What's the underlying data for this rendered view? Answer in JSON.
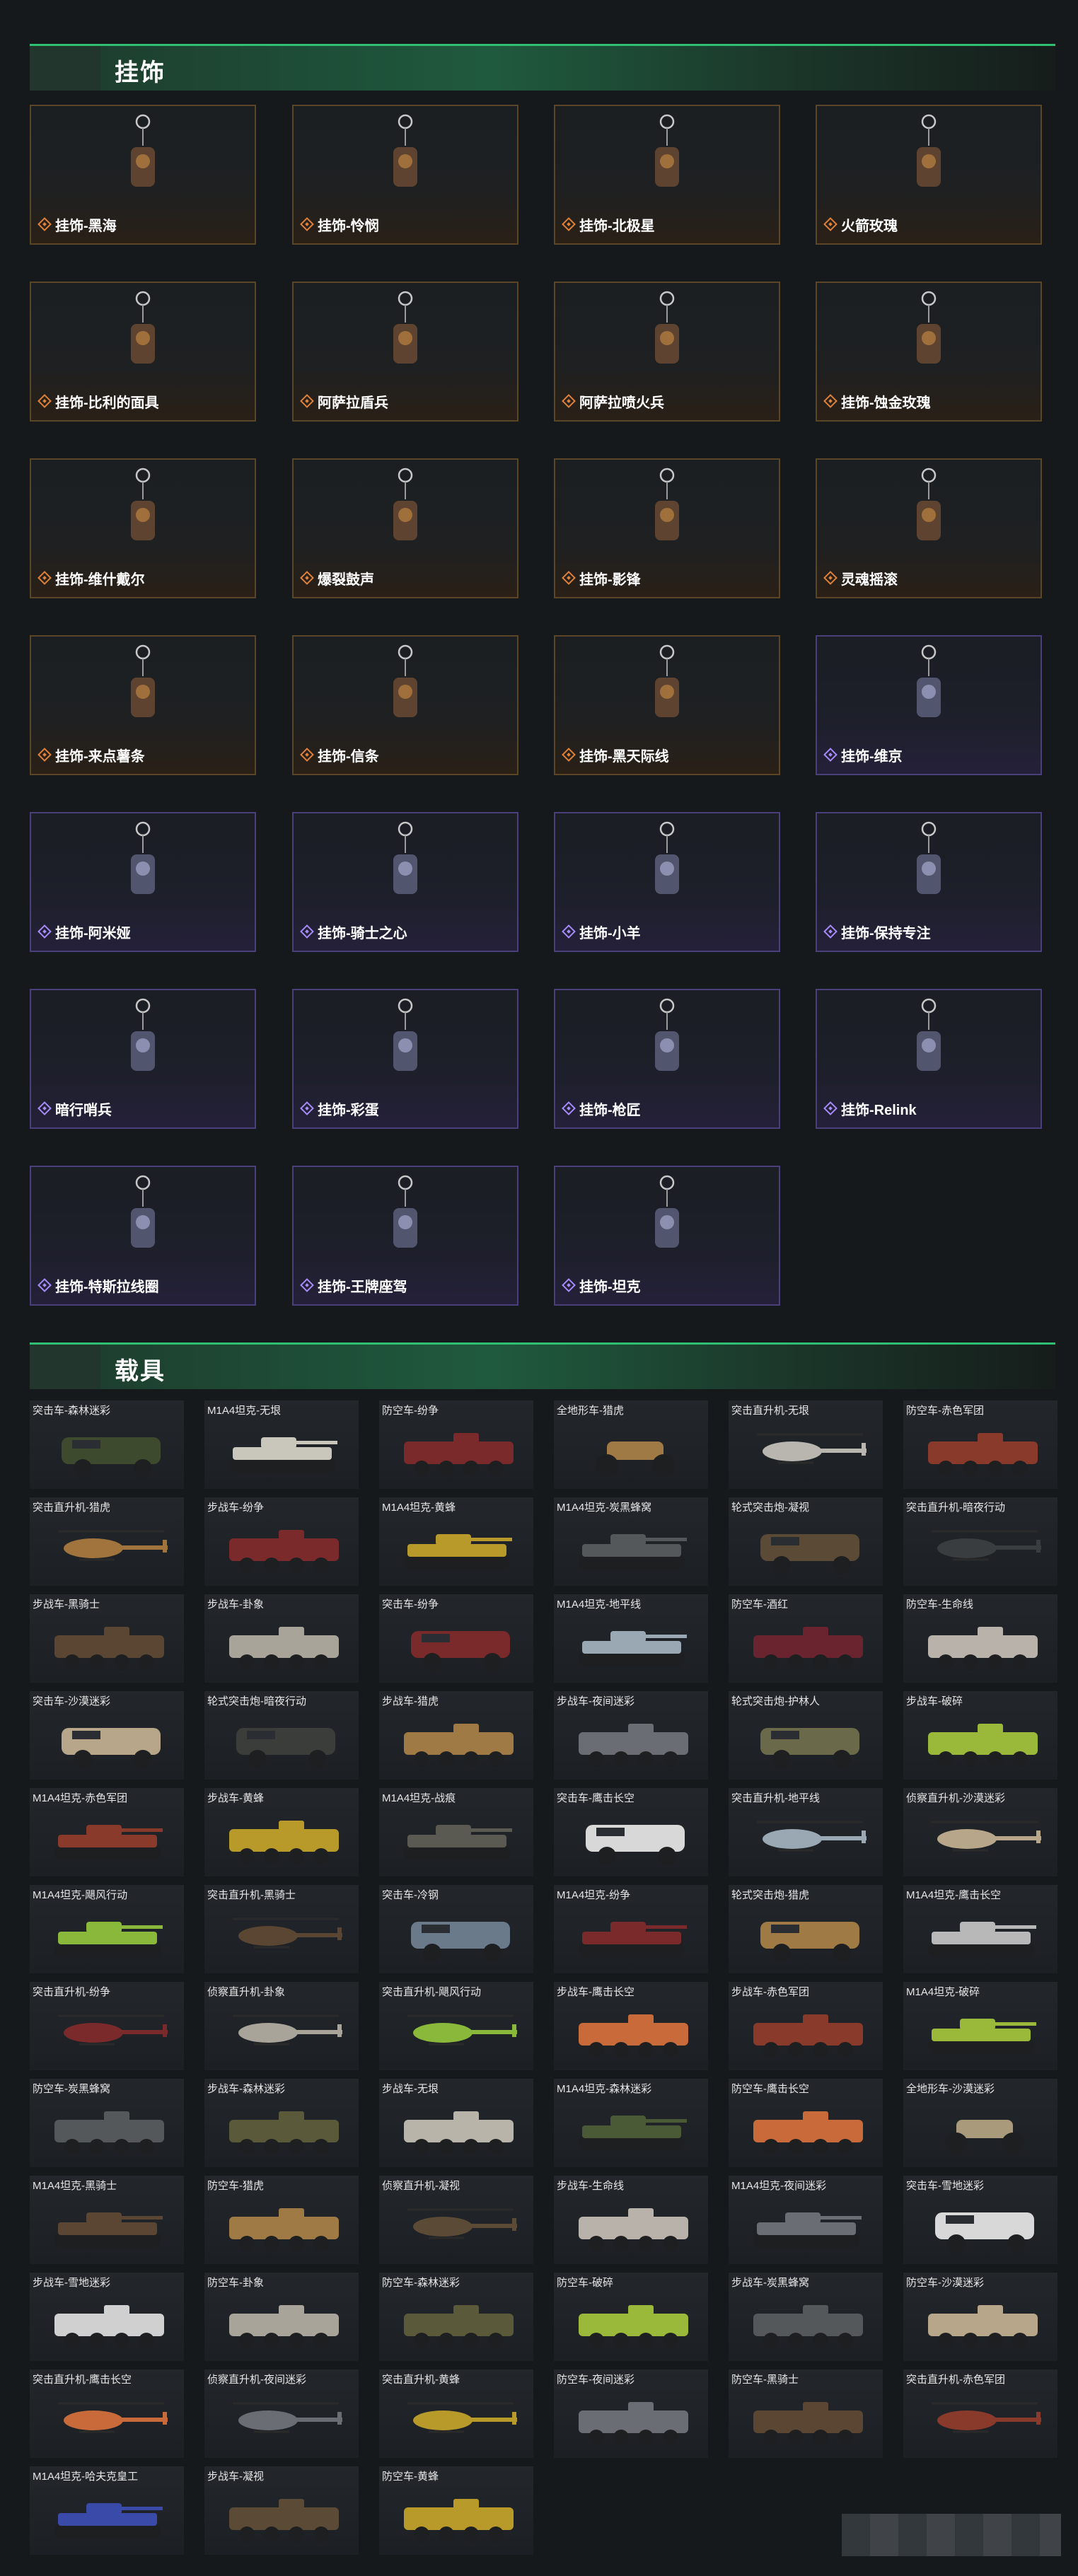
{
  "sections": {
    "charms_title": "挂饰",
    "vehicles_title": "载具"
  },
  "charms": [
    {
      "name": "挂饰-黑海",
      "rarity": "orange"
    },
    {
      "name": "挂饰-怜悯",
      "rarity": "orange"
    },
    {
      "name": "挂饰-北极星",
      "rarity": "orange"
    },
    {
      "name": "火箭玫瑰",
      "rarity": "orange"
    },
    {
      "name": "挂饰-比利的面具",
      "rarity": "orange"
    },
    {
      "name": "阿萨拉盾兵",
      "rarity": "orange"
    },
    {
      "name": "阿萨拉喷火兵",
      "rarity": "orange"
    },
    {
      "name": "挂饰-蚀金玫瑰",
      "rarity": "orange"
    },
    {
      "name": "挂饰-维什戴尔",
      "rarity": "orange"
    },
    {
      "name": "爆裂鼓声",
      "rarity": "orange"
    },
    {
      "name": "挂饰-影锋",
      "rarity": "orange"
    },
    {
      "name": "灵魂摇滚",
      "rarity": "orange"
    },
    {
      "name": "挂饰-来点薯条",
      "rarity": "orange"
    },
    {
      "name": "挂饰-信条",
      "rarity": "orange"
    },
    {
      "name": "挂饰-黑天际线",
      "rarity": "orange"
    },
    {
      "name": "挂饰-维京",
      "rarity": "purple"
    },
    {
      "name": "挂饰-阿米娅",
      "rarity": "purple"
    },
    {
      "name": "挂饰-骑士之心",
      "rarity": "purple"
    },
    {
      "name": "挂饰-小羊",
      "rarity": "purple"
    },
    {
      "name": "挂饰-保持专注",
      "rarity": "purple"
    },
    {
      "name": "暗行哨兵",
      "rarity": "purple"
    },
    {
      "name": "挂饰-彩蛋",
      "rarity": "purple"
    },
    {
      "name": "挂饰-枪匠",
      "rarity": "purple"
    },
    {
      "name": "挂饰-Relink",
      "rarity": "purple"
    },
    {
      "name": "挂饰-特斯拉线圈",
      "rarity": "purple"
    },
    {
      "name": "挂饰-王牌座驾",
      "rarity": "purple"
    },
    {
      "name": "挂饰-坦克",
      "rarity": "purple"
    }
  ],
  "vehicles": [
    {
      "name": "突击车-森林迷彩",
      "kind": "truck",
      "color": "#3d4a2e"
    },
    {
      "name": "M1A4坦克-无垠",
      "kind": "tank",
      "color": "#c9c6bc"
    },
    {
      "name": "防空车-纷争",
      "kind": "apc",
      "color": "#7a2a2a"
    },
    {
      "name": "全地形车-猎虎",
      "kind": "atv",
      "color": "#a07a44"
    },
    {
      "name": "突击直升机-无垠",
      "kind": "heli",
      "color": "#b8b6ae"
    },
    {
      "name": "防空车-赤色军团",
      "kind": "apc",
      "color": "#8a3a2a"
    },
    {
      "name": "突击直升机-猎虎",
      "kind": "heli",
      "color": "#a0743c"
    },
    {
      "name": "步战车-纷争",
      "kind": "apc",
      "color": "#7a2a2a"
    },
    {
      "name": "M1A4坦克-黄蜂",
      "kind": "tank",
      "color": "#b89a2a"
    },
    {
      "name": "M1A4坦克-炭黑蜂窝",
      "kind": "tank",
      "color": "#55585a"
    },
    {
      "name": "轮式突击炮-凝视",
      "kind": "truck",
      "color": "#5a4a36"
    },
    {
      "name": "突击直升机-暗夜行动",
      "kind": "heli",
      "color": "#3a3d40"
    },
    {
      "name": "步战车-黑骑士",
      "kind": "apc",
      "color": "#5a4632"
    },
    {
      "name": "步战车-卦象",
      "kind": "apc",
      "color": "#a8a49a"
    },
    {
      "name": "突击车-纷争",
      "kind": "truck",
      "color": "#7a2a2a"
    },
    {
      "name": "M1A4坦克-地平线",
      "kind": "tank",
      "color": "#9aa8b4"
    },
    {
      "name": "防空车-酒红",
      "kind": "apc",
      "color": "#6a2430"
    },
    {
      "name": "防空车-生命线",
      "kind": "apc",
      "color": "#b8b2aa"
    },
    {
      "name": "突击车-沙漠迷彩",
      "kind": "truck",
      "color": "#b8a68a"
    },
    {
      "name": "轮式突击炮-暗夜行动",
      "kind": "truck",
      "color": "#3a3d3a"
    },
    {
      "name": "步战车-猎虎",
      "kind": "apc",
      "color": "#a07a44"
    },
    {
      "name": "步战车-夜间迷彩",
      "kind": "apc",
      "color": "#6a6e74"
    },
    {
      "name": "轮式突击炮-护林人",
      "kind": "truck",
      "color": "#6a6a4a"
    },
    {
      "name": "步战车-破碎",
      "kind": "apc",
      "color": "#9ab83a"
    },
    {
      "name": "M1A4坦克-赤色军团",
      "kind": "tank",
      "color": "#8a3a2a"
    },
    {
      "name": "步战车-黄蜂",
      "kind": "apc",
      "color": "#b89a2a"
    },
    {
      "name": "M1A4坦克-战痕",
      "kind": "tank",
      "color": "#5a5a52"
    },
    {
      "name": "突击车-鹰击长空",
      "kind": "truck",
      "color": "#d8d8d8"
    },
    {
      "name": "突击直升机-地平线",
      "kind": "heli",
      "color": "#9aa8b4"
    },
    {
      "name": "侦察直升机-沙漠迷彩",
      "kind": "heli",
      "color": "#b8a68a"
    },
    {
      "name": "M1A4坦克-飓风行动",
      "kind": "tank",
      "color": "#8ab83a"
    },
    {
      "name": "突击直升机-黑骑士",
      "kind": "heli",
      "color": "#5a4632"
    },
    {
      "name": "突击车-冷钢",
      "kind": "truck",
      "color": "#6a7a8a"
    },
    {
      "name": "M1A4坦克-纷争",
      "kind": "tank",
      "color": "#7a2a2a"
    },
    {
      "name": "轮式突击炮-猎虎",
      "kind": "truck",
      "color": "#a07a44"
    },
    {
      "name": "M1A4坦克-鹰击长空",
      "kind": "tank",
      "color": "#b8b8b8"
    },
    {
      "name": "突击直升机-纷争",
      "kind": "heli",
      "color": "#7a2a2a"
    },
    {
      "name": "侦察直升机-卦象",
      "kind": "heli",
      "color": "#a8a49a"
    },
    {
      "name": "突击直升机-飓风行动",
      "kind": "heli",
      "color": "#8ab83a"
    },
    {
      "name": "步战车-鹰击长空",
      "kind": "apc",
      "color": "#c86a3a"
    },
    {
      "name": "步战车-赤色军团",
      "kind": "apc",
      "color": "#8a3a2a"
    },
    {
      "name": "M1A4坦克-破碎",
      "kind": "tank",
      "color": "#9ab83a"
    },
    {
      "name": "防空车-炭黑蜂窝",
      "kind": "apc",
      "color": "#55585a"
    },
    {
      "name": "步战车-森林迷彩",
      "kind": "apc",
      "color": "#5a5a3a"
    },
    {
      "name": "步战车-无垠",
      "kind": "apc",
      "color": "#b8b4aa"
    },
    {
      "name": "M1A4坦克-森林迷彩",
      "kind": "tank",
      "color": "#4a5a36"
    },
    {
      "name": "防空车-鹰击长空",
      "kind": "apc",
      "color": "#c86a3a"
    },
    {
      "name": "全地形车-沙漠迷彩",
      "kind": "atv",
      "color": "#a89a7a"
    },
    {
      "name": "M1A4坦克-黑骑士",
      "kind": "tank",
      "color": "#5a4632"
    },
    {
      "name": "防空车-猎虎",
      "kind": "apc",
      "color": "#a07a44"
    },
    {
      "name": "侦察直升机-凝视",
      "kind": "heli",
      "color": "#5a4a36"
    },
    {
      "name": "步战车-生命线",
      "kind": "apc",
      "color": "#b8b2aa"
    },
    {
      "name": "M1A4坦克-夜间迷彩",
      "kind": "tank",
      "color": "#6a6e74"
    },
    {
      "name": "突击车-雪地迷彩",
      "kind": "truck",
      "color": "#d8d8d8"
    },
    {
      "name": "步战车-雪地迷彩",
      "kind": "apc",
      "color": "#d0d0d0"
    },
    {
      "name": "防空车-卦象",
      "kind": "apc",
      "color": "#a8a49a"
    },
    {
      "name": "防空车-森林迷彩",
      "kind": "apc",
      "color": "#5a5a3a"
    },
    {
      "name": "防空车-破碎",
      "kind": "apc",
      "color": "#9ab83a"
    },
    {
      "name": "步战车-炭黑蜂窝",
      "kind": "apc",
      "color": "#55585a"
    },
    {
      "name": "防空车-沙漠迷彩",
      "kind": "apc",
      "color": "#b8a68a"
    },
    {
      "name": "突击直升机-鹰击长空",
      "kind": "heli",
      "color": "#c86a3a"
    },
    {
      "name": "侦察直升机-夜间迷彩",
      "kind": "heli",
      "color": "#6a6e74"
    },
    {
      "name": "突击直升机-黄蜂",
      "kind": "heli",
      "color": "#b89a2a"
    },
    {
      "name": "防空车-夜间迷彩",
      "kind": "apc",
      "color": "#6a6e74"
    },
    {
      "name": "防空车-黑骑士",
      "kind": "apc",
      "color": "#5a4632"
    },
    {
      "name": "突击直升机-赤色军团",
      "kind": "heli",
      "color": "#8a3a2a"
    },
    {
      "name": "M1A4坦克-哈夫克皇工",
      "kind": "tank",
      "color": "#3a4aa8"
    },
    {
      "name": "步战车-凝视",
      "kind": "apc",
      "color": "#5a4a36"
    },
    {
      "name": "防空车-黄蜂",
      "kind": "apc",
      "color": "#b89a2a"
    }
  ]
}
